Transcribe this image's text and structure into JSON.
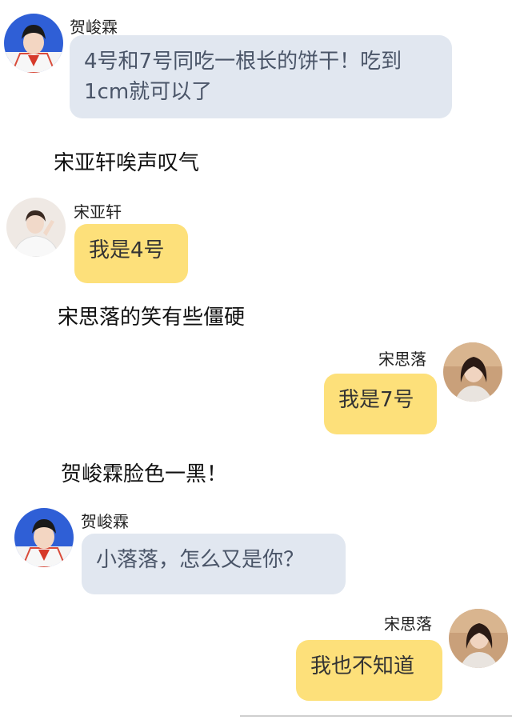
{
  "colors": {
    "other_bubble": "#e1e7f0",
    "self_bubble": "#fde07a",
    "background": "#ffffff"
  },
  "messages": [
    {
      "speaker": "贺峻霖",
      "text": "4号和7号同吃一根长的饼干！吃到1cm就可以了",
      "side": "left",
      "bubble": "gray",
      "avatar": "avatar-he-junlin"
    },
    {
      "narration": "宋亚轩唉声叹气"
    },
    {
      "speaker": "宋亚轩",
      "text": "我是4号",
      "side": "left",
      "bubble": "yellow",
      "avatar": "avatar-song-yaxuan"
    },
    {
      "narration": "宋思落的笑有些僵硬"
    },
    {
      "speaker": "宋思落",
      "text": "我是7号",
      "side": "right",
      "bubble": "yellow",
      "avatar": "avatar-song-siluo"
    },
    {
      "narration": "贺峻霖脸色一黑！"
    },
    {
      "speaker": "贺峻霖",
      "text": "小落落，怎么又是你？",
      "side": "left",
      "bubble": "gray",
      "avatar": "avatar-he-junlin"
    },
    {
      "speaker": "宋思落",
      "text": "我也不知道",
      "side": "right",
      "bubble": "yellow",
      "avatar": "avatar-song-siluo"
    }
  ]
}
